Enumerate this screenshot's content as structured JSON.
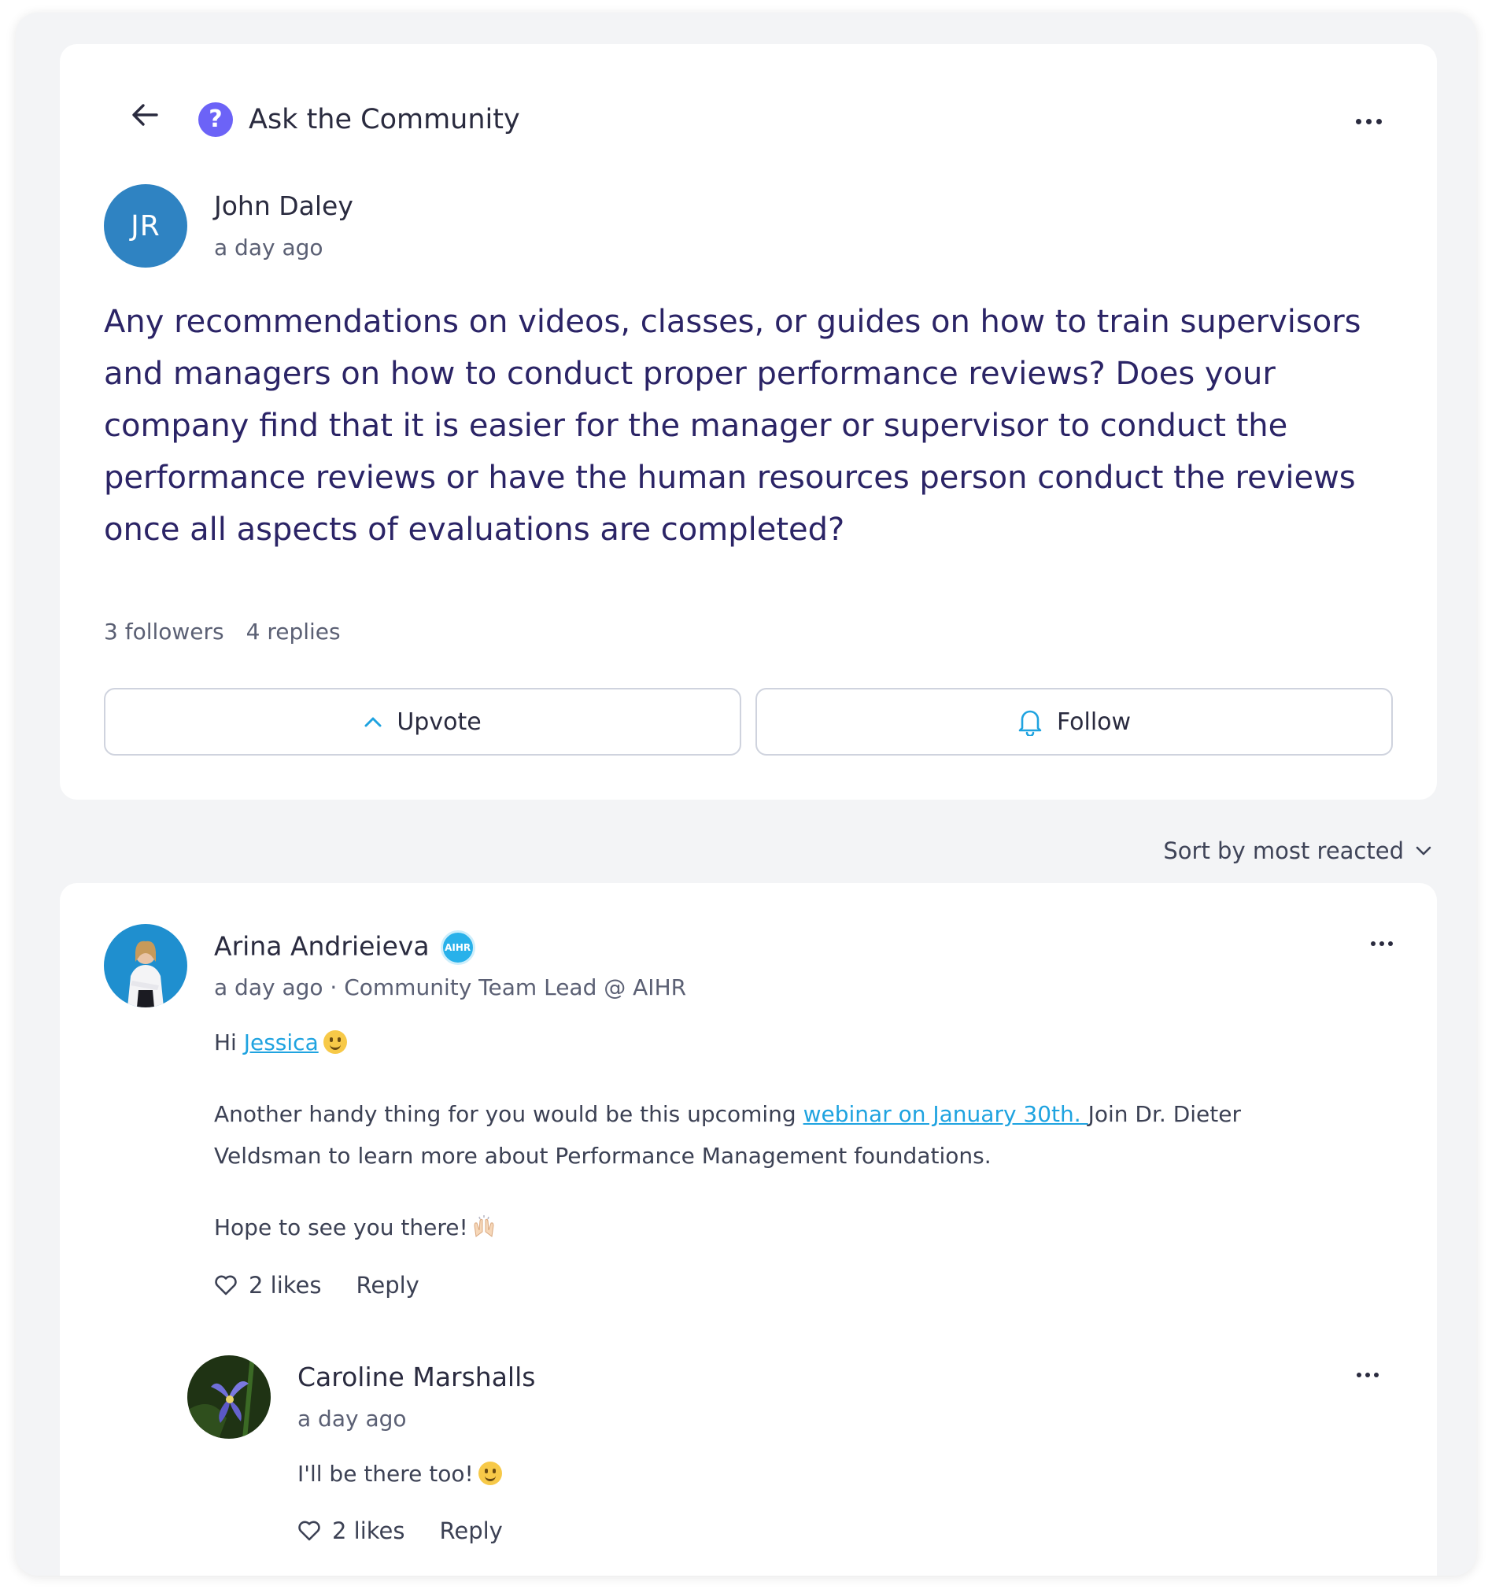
{
  "header": {
    "title": "Ask the Community",
    "more_icon": "ellipsis-icon",
    "back_icon": "arrow-left-icon",
    "title_icon": "question-circle-icon"
  },
  "post": {
    "author_initials": "JR",
    "author_name": "John Daley",
    "time": "a day ago",
    "question": "Any recommendations on videos, classes, or guides on how to train supervisors and managers on how to conduct proper performance reviews? Does your company find that it is easier for the manager or supervisor to conduct the performance reviews or have the human resources person conduct the reviews once all aspects of evaluations are completed?",
    "followers": "3 followers",
    "replies": "4 replies",
    "upvote_label": "Upvote",
    "follow_label": "Follow"
  },
  "sort": {
    "label": "Sort by most reacted"
  },
  "replies": [
    {
      "author_name": "Arina Andrieieva",
      "badge": "AIHR",
      "meta": "a day ago · Community Team Lead @ AIHR",
      "greeting_prefix": "Hi ",
      "mention": "Jessica",
      "para2_prefix": "Another handy thing for you would be this upcoming ",
      "para2_link": "webinar on January 30th. ",
      "para2_suffix": "Join Dr. Dieter Veldsman to learn more about Performance Management foundations.",
      "para3": "Hope to see you there!",
      "likes": "2 likes",
      "reply_label": "Reply"
    },
    {
      "author_name": "Caroline Marshalls",
      "meta": "a day ago",
      "body": "I'll be there too!",
      "likes": "2 likes",
      "reply_label": "Reply"
    }
  ],
  "colors": {
    "accent": "#1fa3e0",
    "question_text": "#2b2466",
    "avatar_jr": "#2f83c2",
    "question_icon": "#6c63f7"
  }
}
